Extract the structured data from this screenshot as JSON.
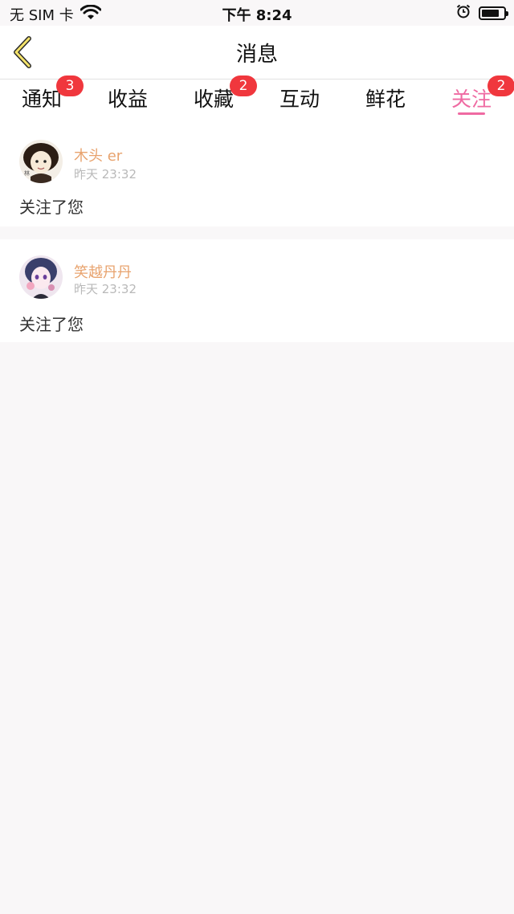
{
  "status_bar": {
    "carrier": "无 SIM 卡",
    "time": "下午 8:24"
  },
  "header": {
    "title": "消息"
  },
  "tabs": [
    {
      "label": "通知",
      "badge": "3"
    },
    {
      "label": "收益",
      "badge": ""
    },
    {
      "label": "收藏",
      "badge": "2"
    },
    {
      "label": "互动",
      "badge": ""
    },
    {
      "label": "鲜花",
      "badge": ""
    },
    {
      "label": "关注",
      "badge": "2",
      "active": true
    }
  ],
  "messages": [
    {
      "username": "木头 er",
      "time": "昨天 23:32",
      "text": "关注了您"
    },
    {
      "username": "笑越丹丹",
      "time": "昨天 23:32",
      "text": "关注了您"
    }
  ],
  "colors": {
    "accent": "#ef6aa2",
    "badge": "#f0373d",
    "username": "#e8a36e"
  }
}
